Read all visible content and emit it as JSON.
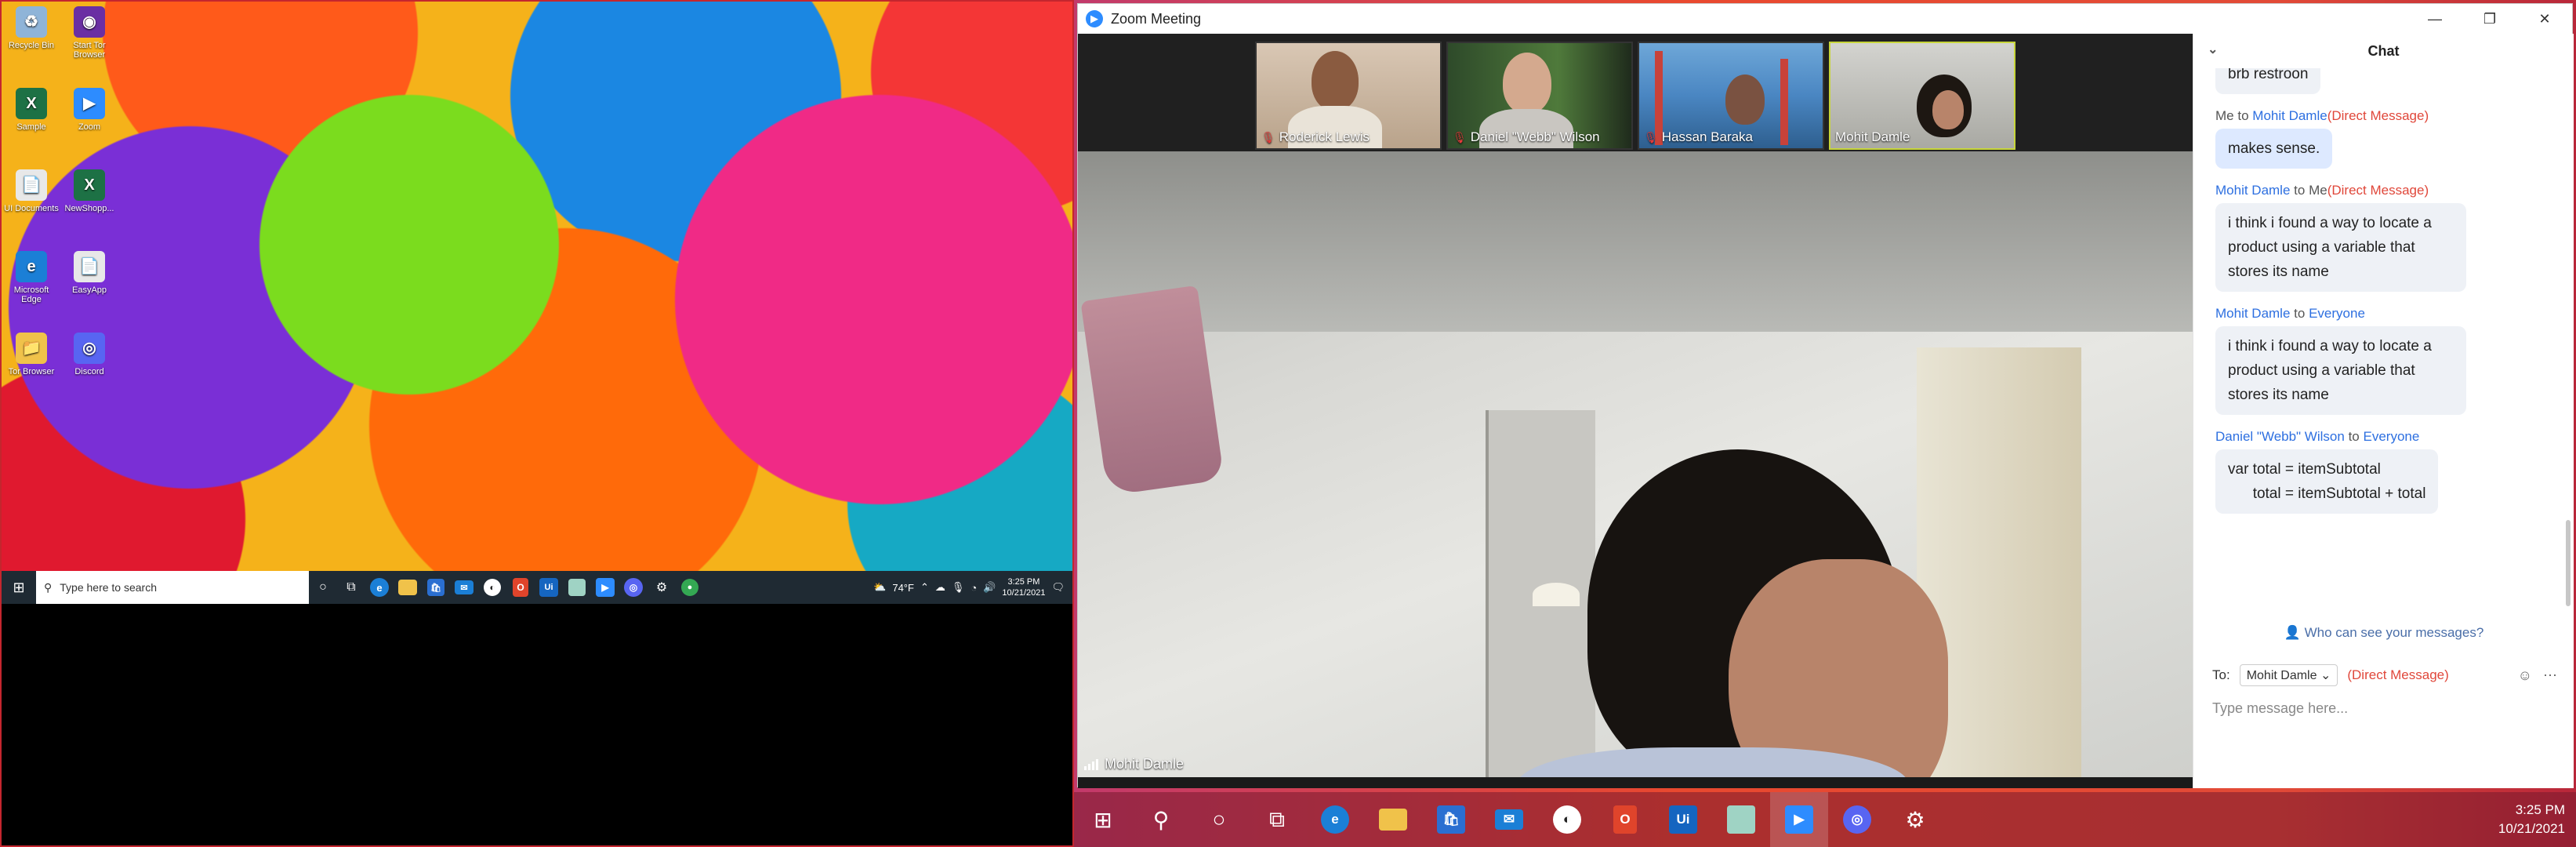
{
  "left_monitor": {
    "desktop_icons": [
      {
        "label": "Recycle Bin",
        "color": "#8fb4d8",
        "glyph": "♻"
      },
      {
        "label": "Start Tor Browser",
        "color": "#6a2fa3",
        "glyph": "◉"
      },
      {
        "label": "Sample",
        "color": "#1d7145",
        "glyph": "X"
      },
      {
        "label": "Zoom",
        "color": "#2d8cff",
        "glyph": "▶"
      },
      {
        "label": "UI Documents",
        "color": "#e8e8e8",
        "glyph": "📄"
      },
      {
        "label": "NewShopp...",
        "color": "#1d7145",
        "glyph": "X"
      },
      {
        "label": "Microsoft Edge",
        "color": "#1b7fd6",
        "glyph": "e"
      },
      {
        "label": "EasyApp",
        "color": "#e8e8e8",
        "glyph": "📄"
      },
      {
        "label": "Tor Browser",
        "color": "#f0c24a",
        "glyph": "📁"
      },
      {
        "label": "Discord",
        "color": "#5865f2",
        "glyph": "◎"
      }
    ],
    "taskbar": {
      "search_placeholder": "Type here to search",
      "weather": "74°F",
      "time": "3:25 PM",
      "date": "10/21/2021"
    }
  },
  "zoom": {
    "window_title": "Zoom Meeting",
    "participants": [
      {
        "name": "Roderick Lewis",
        "muted": true
      },
      {
        "name": "Daniel \"Webb\" Wilson",
        "muted": true
      },
      {
        "name": "Hassan Baraka",
        "muted": true
      },
      {
        "name": "Mohit Damle",
        "muted": false
      }
    ],
    "active_speaker": "Mohit Damle"
  },
  "chat": {
    "title": "Chat",
    "partial_message": "brb restroon",
    "messages": [
      {
        "from": "Me",
        "conj": "to",
        "to": "Mohit Damle",
        "tag": "(Direct Message)",
        "text": "makes sense.",
        "mine": true
      },
      {
        "from": "Mohit Damle",
        "conj": "to",
        "to": "Me",
        "tag": "(Direct Message)",
        "text": "i think i found a way to locate a product using a variable that stores its name",
        "mine": false
      },
      {
        "from": "Mohit Damle",
        "conj": "to",
        "to": "Everyone",
        "tag": "",
        "text": "i think i found a way to locate a product using a variable that stores its name",
        "mine": false
      },
      {
        "from": "Daniel \"Webb\" Wilson",
        "conj": "to",
        "to": "Everyone",
        "tag": "",
        "text": "var total = itemSubtotal\n      total = itemSubtotal + total",
        "mine": false
      }
    ],
    "who_can_see": "Who can see your messages?",
    "to_label": "To:",
    "recipient": "Mohit Damle",
    "recipient_tag": "(Direct Message)",
    "input_placeholder": "Type message here..."
  },
  "right_taskbar": {
    "time": "3:25 PM",
    "date": "10/21/2021"
  }
}
